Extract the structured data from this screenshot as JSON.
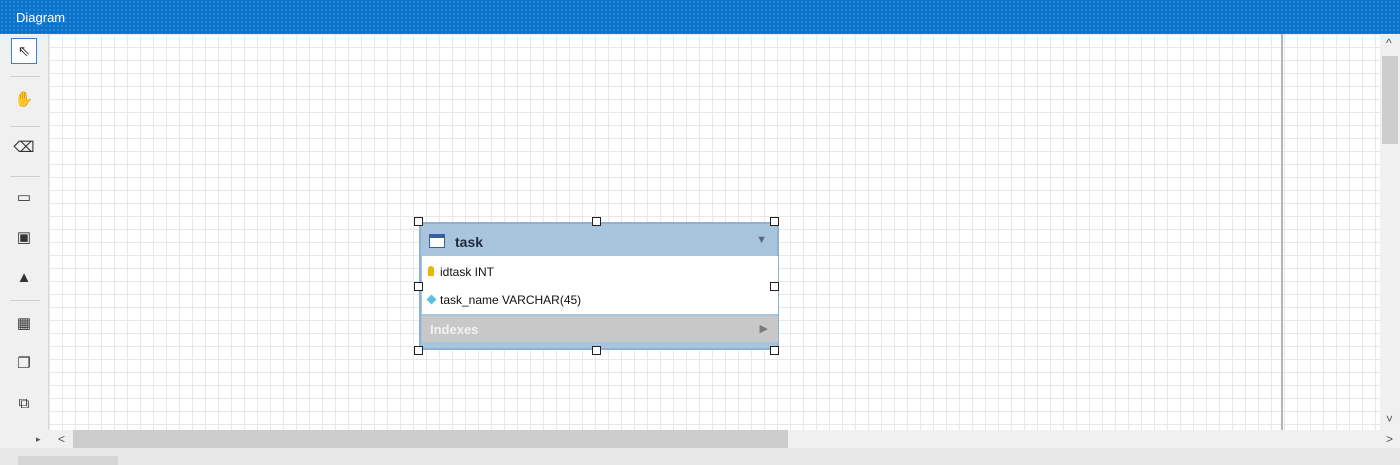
{
  "panel": {
    "title": "Diagram"
  },
  "toolbar": {
    "tools": [
      {
        "name": "pointer-tool",
        "icon": "⇖"
      },
      {
        "name": "hand-tool",
        "icon": "✋"
      },
      {
        "name": "eraser-tool",
        "icon": "⌫"
      },
      {
        "name": "layer-tool",
        "icon": "▭"
      },
      {
        "name": "note-tool",
        "icon": "▣"
      },
      {
        "name": "image-tool",
        "icon": "▲"
      },
      {
        "name": "table-tool",
        "icon": "▦"
      },
      {
        "name": "view-tool",
        "icon": "❐"
      },
      {
        "name": "routine-tool",
        "icon": "⧉"
      }
    ]
  },
  "table": {
    "name": "task",
    "columns": [
      {
        "name": "idtask INT",
        "kind": "primary-key"
      },
      {
        "name": "task_name VARCHAR(45)",
        "kind": "column"
      }
    ],
    "indexes_label": "Indexes"
  },
  "scroll": {
    "up": "^",
    "down": "˅",
    "left": "<",
    "right": ">"
  }
}
